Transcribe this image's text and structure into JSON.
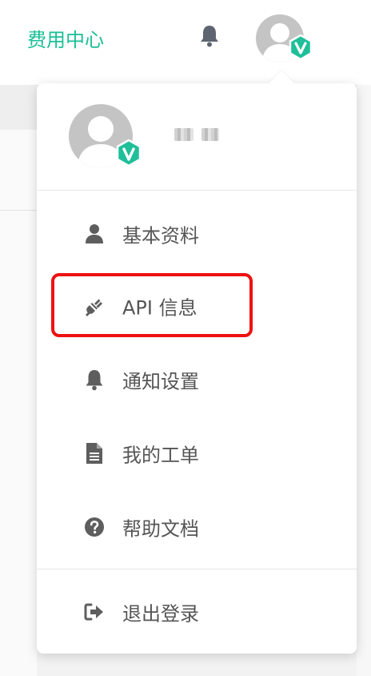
{
  "header": {
    "fee_center": "费用中心",
    "bell_icon": "bell-icon",
    "avatar_icon": "user-avatar-icon",
    "vip_badge": "v"
  },
  "dropdown": {
    "username": "",
    "avatar_icon": "user-avatar-icon",
    "vip_badge": "v",
    "items": [
      {
        "label": "基本资料",
        "icon": "user-icon"
      },
      {
        "label": "API 信息",
        "icon": "plug-icon",
        "highlighted": true
      },
      {
        "label": "通知设置",
        "icon": "bell-icon"
      },
      {
        "label": "我的工单",
        "icon": "document-icon"
      },
      {
        "label": "帮助文档",
        "icon": "question-circle-icon"
      }
    ],
    "logout": {
      "label": "退出登录",
      "icon": "sign-out-icon"
    }
  },
  "colors": {
    "accent": "#1bbf96",
    "badge": "#1fbf99",
    "highlight_border": "#ee1111",
    "menu_text": "#555555",
    "icon": "#5e5e5e"
  }
}
